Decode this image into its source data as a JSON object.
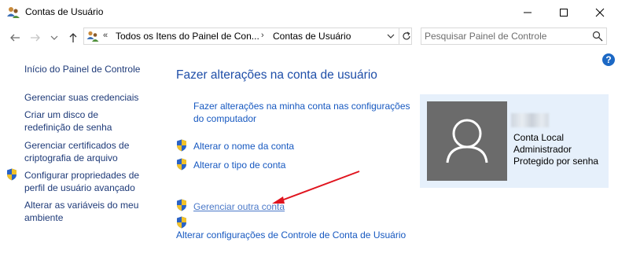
{
  "window": {
    "title": "Contas de Usuário"
  },
  "nav": {
    "chevron": "«",
    "breadcrumb": [
      "Todos os Itens do Painel de Con...",
      "Contas de Usuário"
    ],
    "separator": "›",
    "search_placeholder": "Pesquisar Painel de Controle",
    "help_label": "?"
  },
  "sidebar": {
    "items": [
      {
        "label": "Início do Painel de Controle",
        "shield": false
      },
      {
        "label": "Gerenciar suas credenciais",
        "shield": false
      },
      {
        "label": "Criar um disco de redefinição de senha",
        "shield": false
      },
      {
        "label": "Gerenciar certificados de criptografia de arquivo",
        "shield": false
      },
      {
        "label": "Configurar propriedades de perfil de usuário avançado",
        "shield": true
      },
      {
        "label": "Alterar as variáveis do meu ambiente",
        "shield": false
      }
    ]
  },
  "main": {
    "title": "Fazer alterações na conta de usuário",
    "links": [
      {
        "label": "Fazer alterações na minha conta nas configurações do computador",
        "shield": false
      },
      {
        "label": "Alterar o nome da conta",
        "shield": true
      },
      {
        "label": "Alterar o tipo de conta",
        "shield": true
      },
      {
        "label": "Gerenciar outra conta",
        "shield": true
      },
      {
        "label": "Alterar configurações de Controle de Conta de Usuário",
        "shield": true
      }
    ]
  },
  "account": {
    "type": "Conta Local",
    "role": "Administrador",
    "protection": "Protegido por senha"
  },
  "colors": {
    "link": "#1658c0",
    "accent": "#1c68c4",
    "card_bg": "#e6f0fb",
    "avatar_bg": "#6b6b6b",
    "annotation_arrow": "#e0141e"
  }
}
